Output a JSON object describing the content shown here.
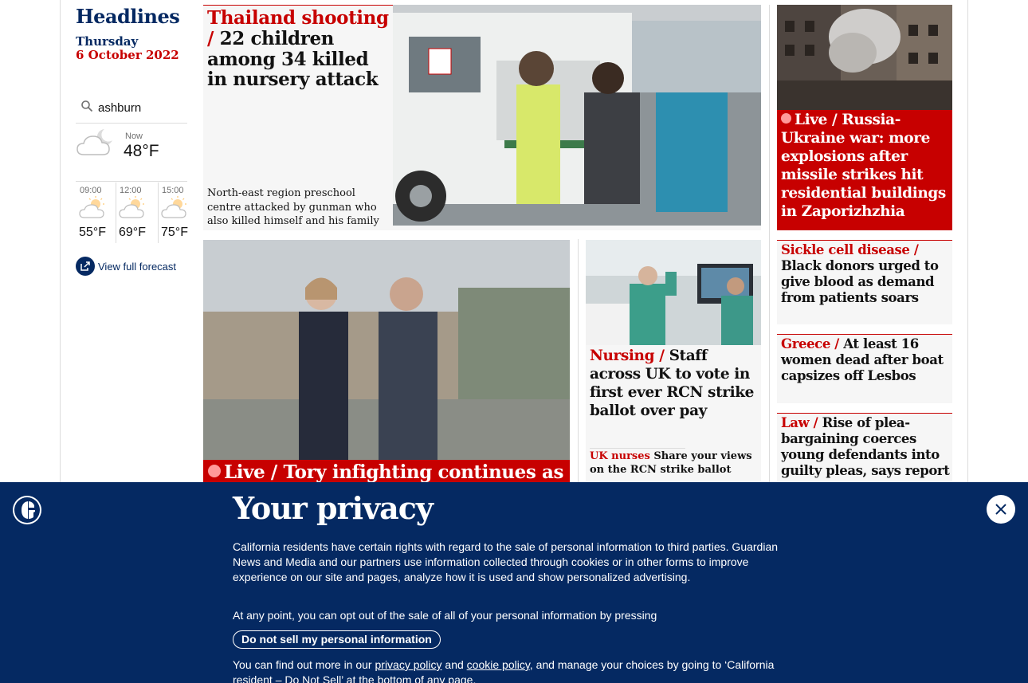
{
  "sidebar": {
    "title": "Headlines",
    "date_day": "Thursday",
    "date_full": "6 October 2022",
    "weather": {
      "location": "ashburn",
      "now_label": "Now",
      "now_temp": "48°F",
      "forecast": [
        {
          "time": "09:00",
          "temp": "55°F"
        },
        {
          "time": "12:00",
          "temp": "69°F"
        },
        {
          "time": "15:00",
          "temp": "75°F"
        }
      ],
      "full_forecast": "View full forecast"
    }
  },
  "lead": {
    "kicker": "Thailand shooting",
    "separator": "/",
    "headline": "22 children among 34 killed in nursery attack",
    "standfirst": "North-east region preschool centre attacked by gunman who also killed himself and his family"
  },
  "right_live": {
    "live": "Live",
    "separator": "/",
    "headline": "Russia-Ukraine war: more explosions after missile strikes hit residential buildings in Zaporizhzhia"
  },
  "mid_big": {
    "live": "Live",
    "separator": "/",
    "headline": "Tory infighting continues as"
  },
  "nursing": {
    "kicker": "Nursing",
    "separator": "/",
    "headline": "Staff across UK to vote in first ever RCN strike ballot over pay",
    "sub_kicker": "UK nurses",
    "sub_text": "Share your views on the RCN strike ballot"
  },
  "side_stories": [
    {
      "kicker": "Sickle cell disease",
      "separator": "/",
      "headline": "Black donors urged to give blood as demand from patients soars"
    },
    {
      "kicker": "Greece",
      "separator": "/",
      "headline": "At least 16 women dead after boat capsizes off Lesbos"
    },
    {
      "kicker": "Law",
      "separator": "/",
      "headline": "Rise of plea-bargaining coerces young defendants into guilty pleas, says report"
    }
  ],
  "privacy": {
    "title": "Your privacy",
    "p1": "California residents have certain rights with regard to the sale of personal information to third parties. Guardian News and Media and our partners use information collected through cookies or in other forms to improve experience on our site and pages, analyze how it is used and show personalized advertising.",
    "p2": "At any point, you can opt out of the sale of all of your personal information by pressing",
    "dns_button": "Do not sell my personal information",
    "p3_before": "You can find out more in our",
    "privacy_link": "privacy policy",
    "and": "and",
    "cookie_link": "cookie policy",
    "p3_after": ", and manage your choices by going to ‘California resident – Do Not Sell’ at the bottom of any page."
  },
  "colors": {
    "brand_blue": "#052962",
    "news_red": "#c70000",
    "card_bg": "#f6f6f6"
  }
}
